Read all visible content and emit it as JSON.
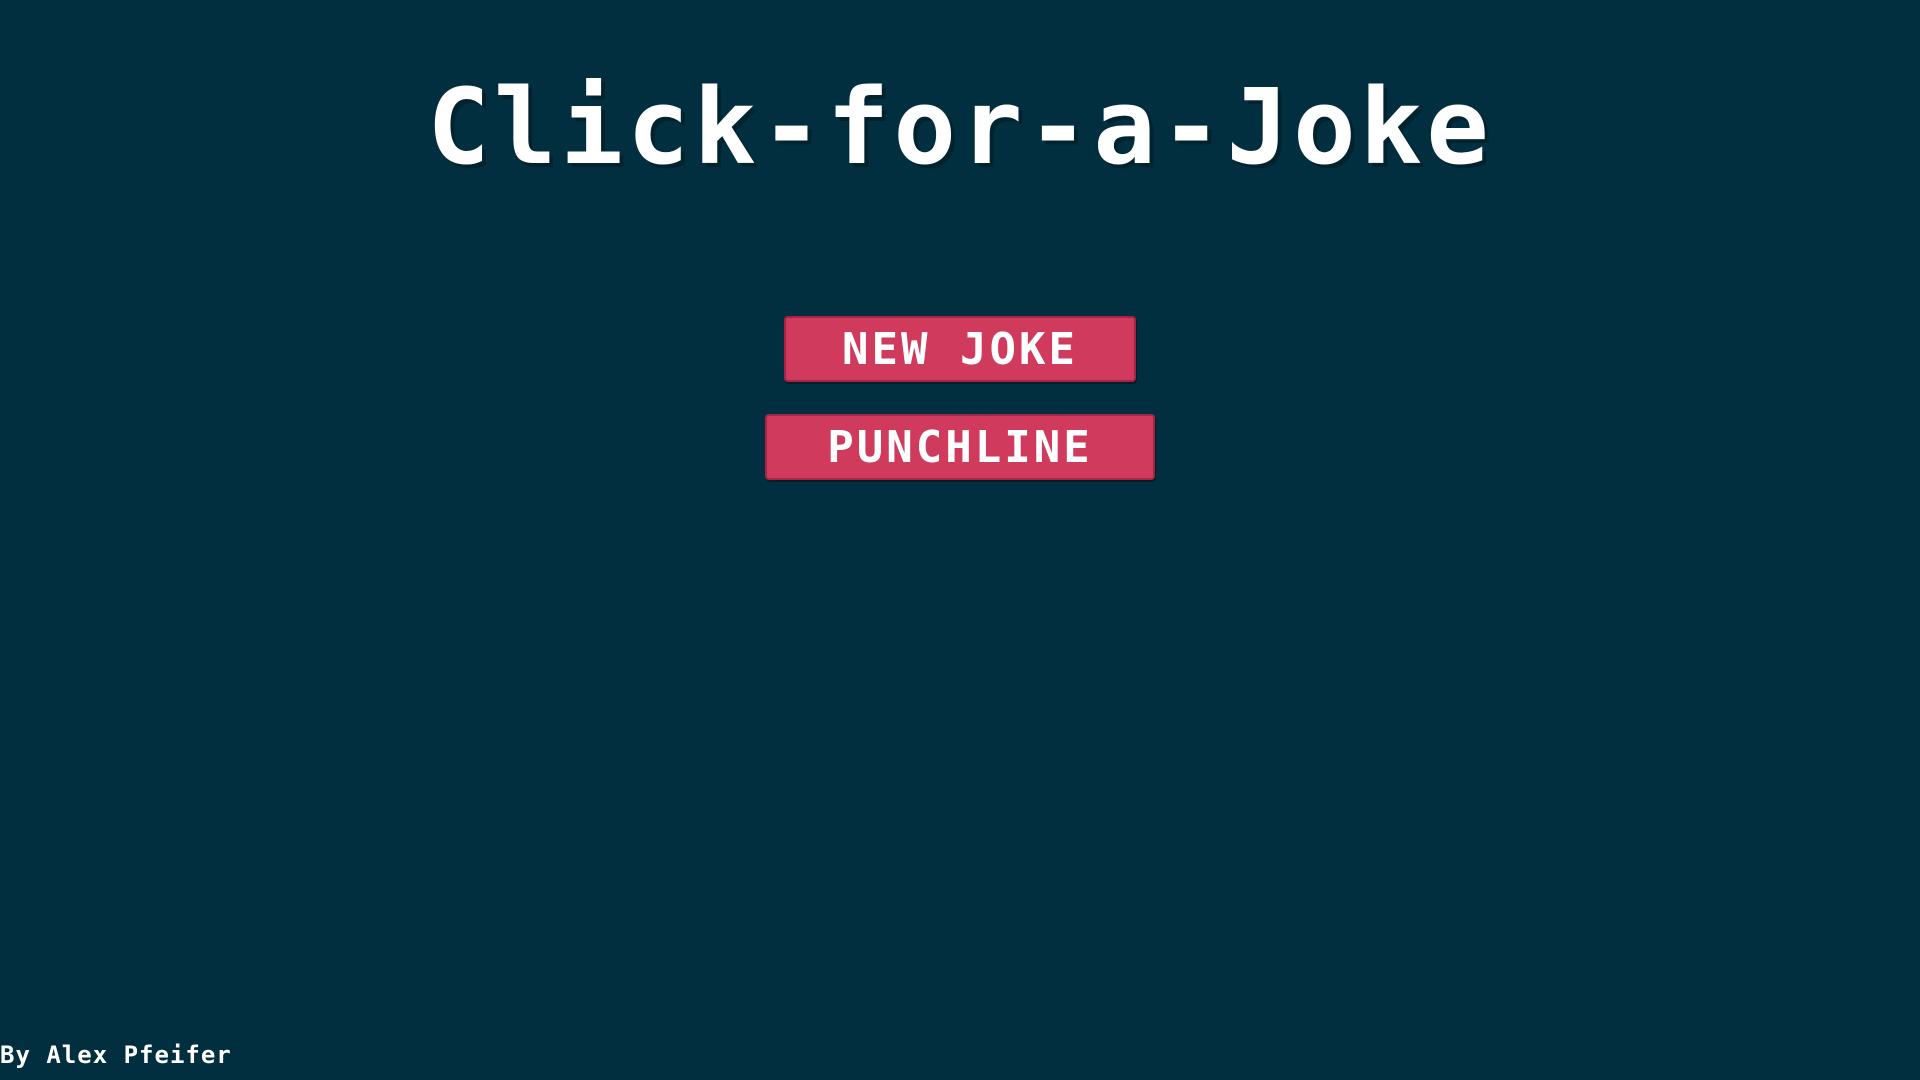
{
  "header": {
    "title": "Click-for-a-Joke"
  },
  "buttons": {
    "new_joke_label": "NEW JOKE",
    "punchline_label": "PUNCHLINE"
  },
  "footer": {
    "credit": "By Alex Pfeifer"
  },
  "colors": {
    "background": "#022f3f",
    "button": "#cf3a5d",
    "text": "#ffffff"
  }
}
